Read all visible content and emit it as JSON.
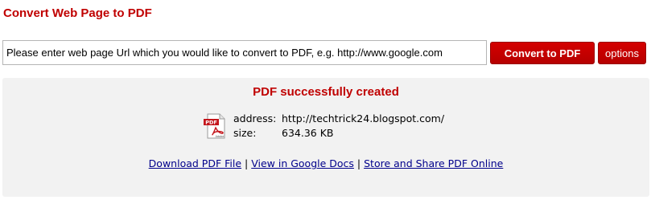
{
  "page": {
    "title": "Convert Web Page to PDF"
  },
  "form": {
    "url_value": "Please enter web page Url which you would like to convert to PDF, e.g. http://www.google.com",
    "convert_label": "Convert to PDF",
    "options_label": "options"
  },
  "result": {
    "heading": "PDF successfully created",
    "icon": "pdf-file-icon",
    "address_label": "address:",
    "address_value": "http://techtrick24.blogspot.com/",
    "size_label": "size:",
    "size_value": "634.36 KB",
    "links": [
      {
        "label": "Download PDF File"
      },
      {
        "label": "View in Google Docs"
      },
      {
        "label": "Store and Share PDF Online"
      }
    ],
    "separator": "|"
  },
  "colors": {
    "accent": "#c00000",
    "link": "#00008b",
    "panel_bg": "#f2f2f2"
  }
}
